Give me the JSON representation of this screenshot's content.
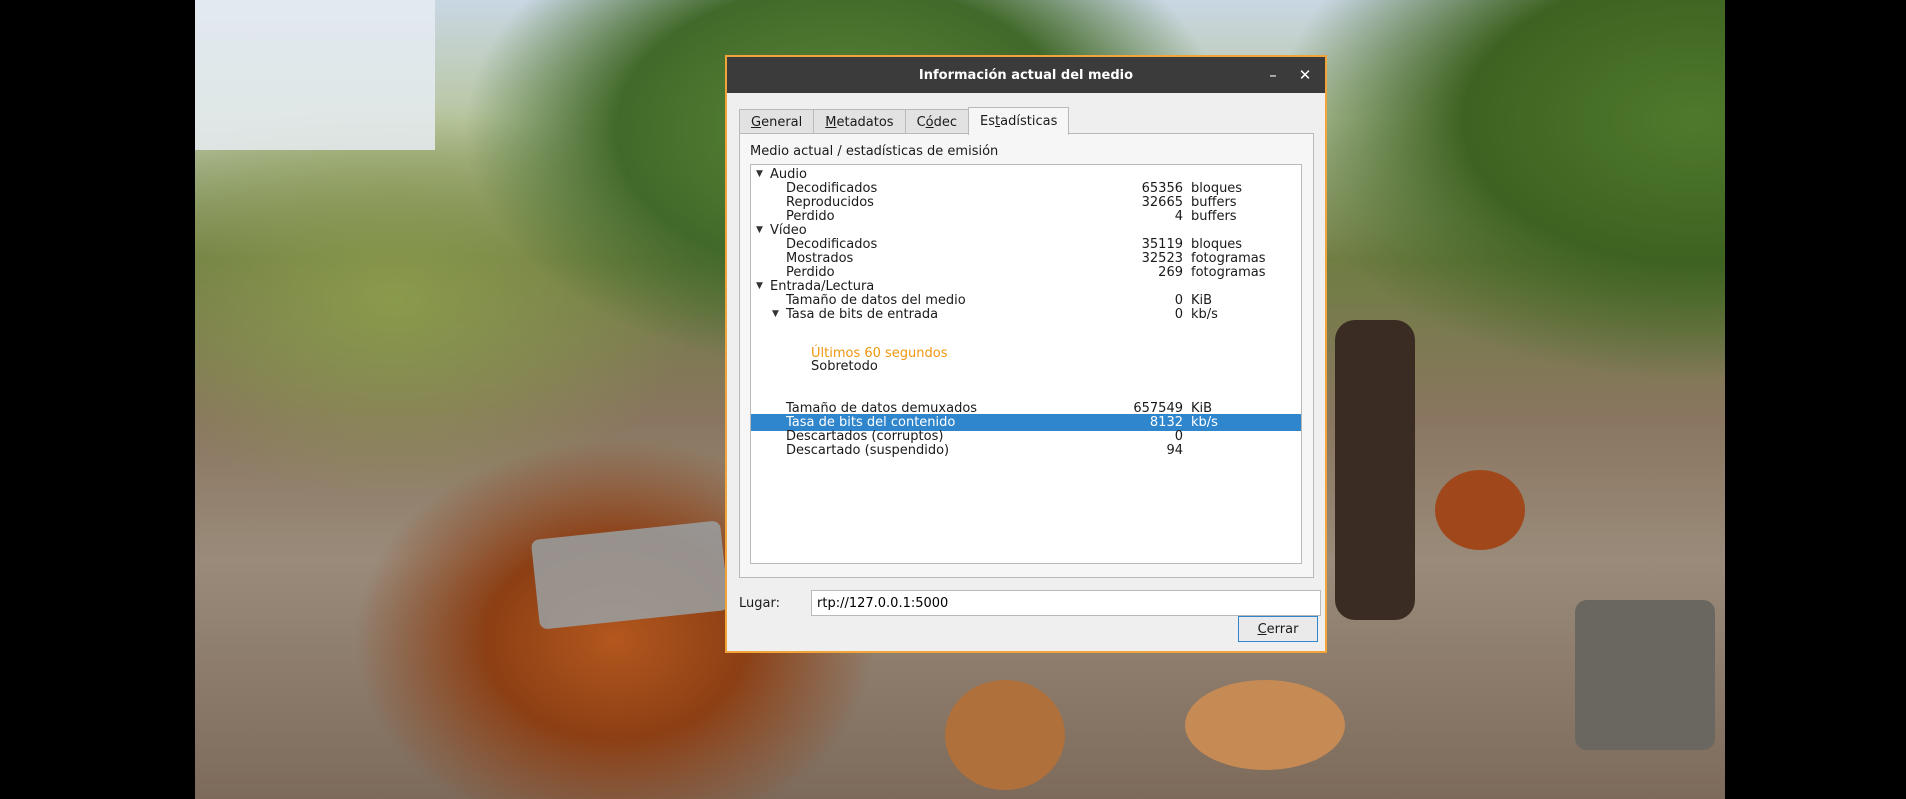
{
  "dialog": {
    "title": "Información actual del medio",
    "minimize_glyph": "–",
    "close_glyph": "✕"
  },
  "tabs": [
    {
      "label": "General",
      "accel": "G",
      "rest": "eneral",
      "pre": ""
    },
    {
      "label": "Metadatos",
      "accel": "M",
      "rest": "etadatos",
      "pre": ""
    },
    {
      "label": "Códec",
      "accel": "ó",
      "rest": "dec",
      "pre": "C"
    },
    {
      "label": "Estadísticas",
      "accel": "t",
      "rest": "adísticas",
      "pre": "Es"
    }
  ],
  "panel": {
    "heading": "Medio actual / estadísticas de emisión"
  },
  "stats": {
    "audio": {
      "label": "Audio",
      "rows": [
        {
          "label": "Decodificados",
          "value": "65356",
          "unit": "bloques"
        },
        {
          "label": "Reproducidos",
          "value": "32665",
          "unit": "buffers"
        },
        {
          "label": "Perdido",
          "value": "4",
          "unit": "buffers"
        }
      ]
    },
    "video": {
      "label": "Vídeo",
      "rows": [
        {
          "label": "Decodificados",
          "value": "35119",
          "unit": "bloques"
        },
        {
          "label": "Mostrados",
          "value": "32523",
          "unit": "fotogramas"
        },
        {
          "label": "Perdido",
          "value": "269",
          "unit": "fotogramas"
        }
      ]
    },
    "input": {
      "label": "Entrada/Lectura",
      "media_size": {
        "label": "Tamaño de datos del medio",
        "value": "0",
        "unit": "KiB"
      },
      "input_bitrate": {
        "label": "Tasa de bits de entrada",
        "value": "0",
        "unit": "kb/s"
      },
      "legend_last60": "Últimos 60 segundos",
      "legend_overall": "Sobretodo",
      "demuxed_size": {
        "label": "Tamaño de datos demuxados",
        "value": "657549",
        "unit": "KiB"
      },
      "content_bitrate": {
        "label": "Tasa de bits del contenido",
        "value": "8132",
        "unit": "kb/s"
      },
      "discarded_corrupt": {
        "label": "Descartados (corruptos)",
        "value": "0"
      },
      "discarded_suspended": {
        "label": "Descartado (suspendido)",
        "value": "94"
      }
    }
  },
  "location": {
    "label": "Lugar:",
    "value": "rtp://127.0.0.1:5000"
  },
  "close_button": {
    "accel": "C",
    "rest": "errar"
  },
  "colors": {
    "titlebar": "#3b3b3b",
    "dialog_border": "#f0a43a",
    "selection": "#2f86cd",
    "legend_orange": "#f0960f"
  }
}
